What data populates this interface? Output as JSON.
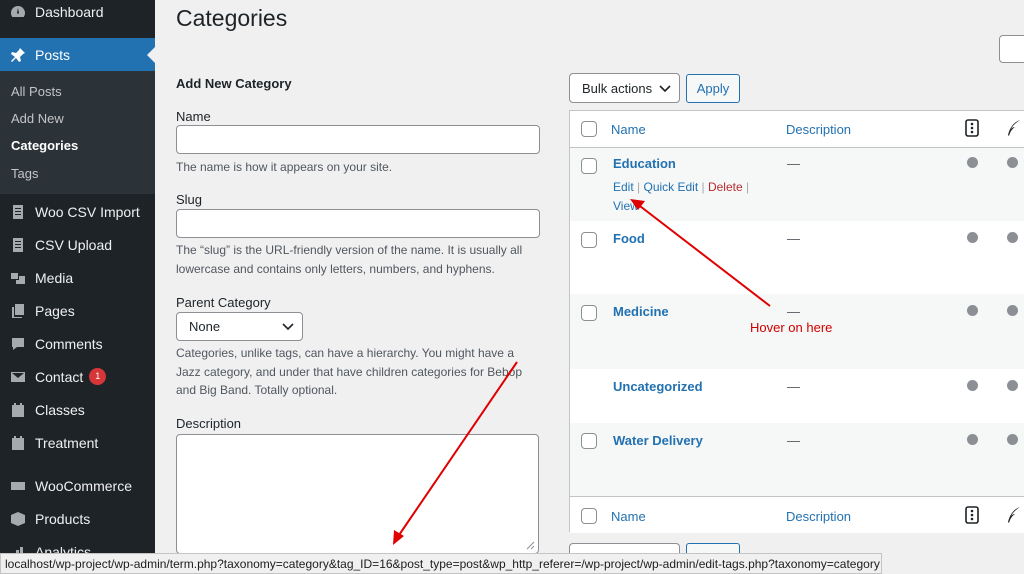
{
  "sidebar": {
    "items": [
      {
        "label": "Dashboard",
        "icon": "dashboard-icon"
      },
      {
        "label": "Posts",
        "icon": "pushpin-icon"
      },
      {
        "label": "Woo CSV Import",
        "icon": "document-icon"
      },
      {
        "label": "CSV Upload",
        "icon": "document-icon"
      },
      {
        "label": "Media",
        "icon": "media-icon"
      },
      {
        "label": "Pages",
        "icon": "pages-icon"
      },
      {
        "label": "Comments",
        "icon": "comment-icon"
      },
      {
        "label": "Contact",
        "icon": "envelope-icon",
        "badge": "1"
      },
      {
        "label": "Classes",
        "icon": "calendar-icon"
      },
      {
        "label": "Treatment",
        "icon": "calendar-icon"
      },
      {
        "label": "WooCommerce",
        "icon": "woo-icon"
      },
      {
        "label": "Products",
        "icon": "box-icon"
      },
      {
        "label": "Analytics",
        "icon": "chart-icon"
      }
    ],
    "submenu": [
      "All Posts",
      "Add New",
      "Categories",
      "Tags"
    ]
  },
  "page": {
    "title": "Categories"
  },
  "form": {
    "heading": "Add New Category",
    "name_label": "Name",
    "name_help": "The name is how it appears on your site.",
    "slug_label": "Slug",
    "slug_help": "The “slug” is the URL-friendly version of the name. It is usually all lowercase and contains only letters, numbers, and hyphens.",
    "parent_label": "Parent Category",
    "parent_value": "None",
    "parent_help": "Categories, unlike tags, can have a hierarchy. You might have a Jazz category, and under that have children categories for Bebop and Big Band. Totally optional.",
    "description_label": "Description"
  },
  "table": {
    "bulk_actions": "Bulk actions",
    "apply": "Apply",
    "col_name": "Name",
    "col_description": "Description",
    "rows": [
      {
        "name": "Education",
        "description": "—",
        "actions": {
          "edit": "Edit",
          "quick_edit": "Quick Edit",
          "delete": "Delete",
          "view": "View"
        }
      },
      {
        "name": "Food",
        "description": "—"
      },
      {
        "name": "Medicine",
        "description": "—"
      },
      {
        "name": "Uncategorized",
        "description": "—"
      },
      {
        "name": "Water Delivery",
        "description": "—"
      }
    ]
  },
  "annotation": {
    "hover_note": "Hover on here",
    "color": "#e00000"
  },
  "statusbar": {
    "url": "localhost/wp-project/wp-admin/term.php?taxonomy=category&tag_ID=16&post_type=post&wp_http_referer=/wp-project/wp-admin/edit-tags.php?taxonomy=category"
  }
}
